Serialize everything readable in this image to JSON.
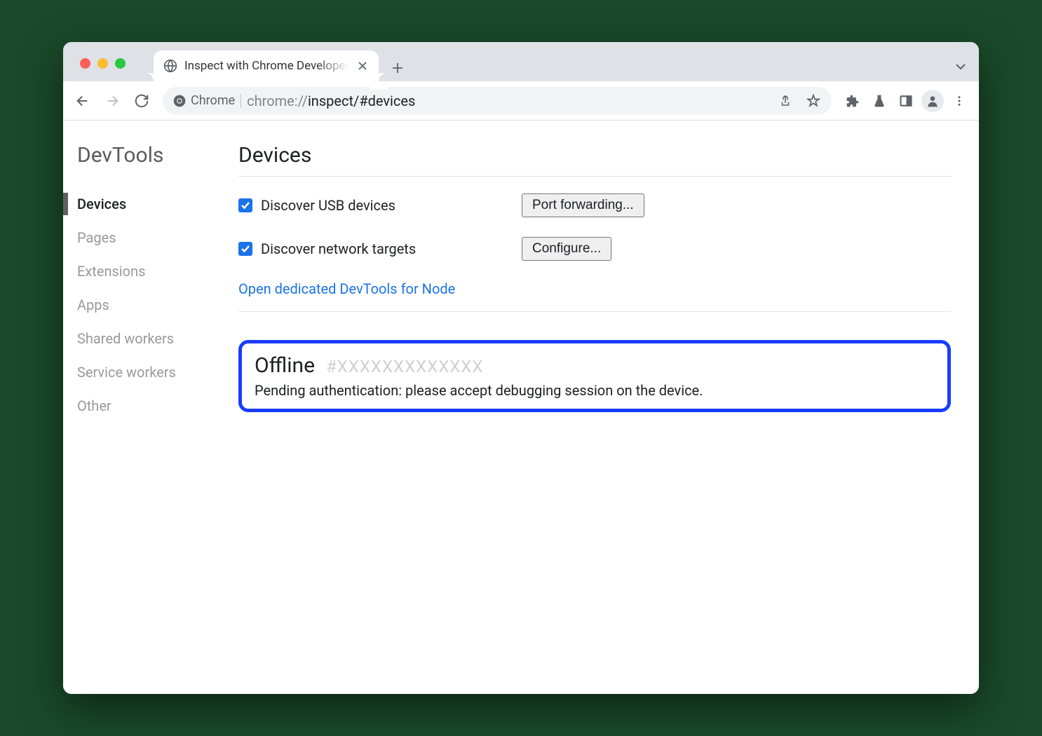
{
  "tab": {
    "title": "Inspect with Chrome Developer"
  },
  "omnibox": {
    "prefix": "Chrome",
    "url_bold": "chrome://",
    "url_rest": "inspect/#devices"
  },
  "sidebar": {
    "title": "DevTools",
    "items": [
      "Devices",
      "Pages",
      "Extensions",
      "Apps",
      "Shared workers",
      "Service workers",
      "Other"
    ],
    "active_index": 0
  },
  "main": {
    "title": "Devices",
    "discover_usb_label": "Discover USB devices",
    "port_forwarding_label": "Port forwarding...",
    "discover_network_label": "Discover network targets",
    "configure_label": "Configure...",
    "node_link": "Open dedicated DevTools for Node",
    "offline": {
      "title": "Offline",
      "hash": "#XXXXXXXXXXXXX",
      "message": "Pending authentication: please accept debugging session on the device."
    }
  }
}
